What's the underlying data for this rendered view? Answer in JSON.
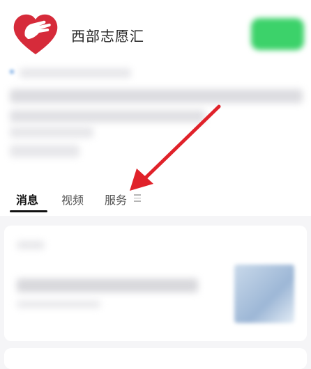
{
  "account": {
    "name": "西部志愿汇"
  },
  "tabs": [
    {
      "label": "消息"
    },
    {
      "label": "视频"
    },
    {
      "label": "服务"
    }
  ],
  "colors": {
    "brand_red": "#d62b3a",
    "follow_green": "#3cd26a",
    "arrow_red": "#e0222a"
  },
  "icons": [
    "heart-hand-logo-icon",
    "menu-lines-icon",
    "red-arrow-annotation-icon"
  ]
}
